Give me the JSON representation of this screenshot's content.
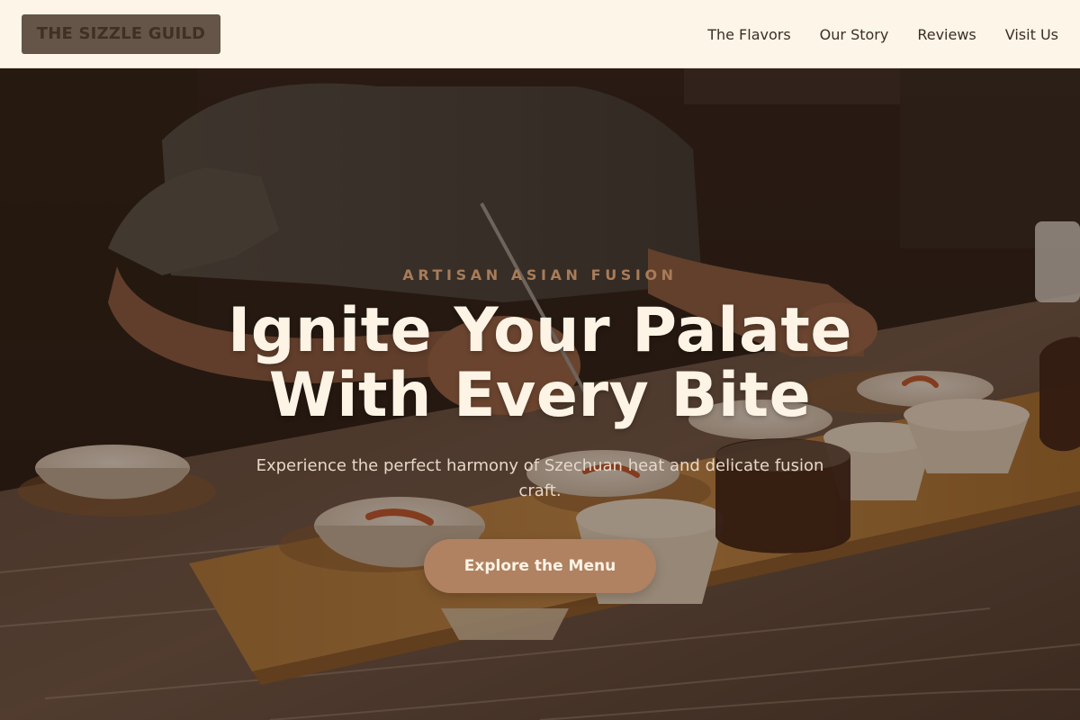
{
  "header": {
    "logo_text": "THE SIZZLE GUILD",
    "nav": [
      {
        "label": "The Flavors"
      },
      {
        "label": "Our Story"
      },
      {
        "label": "Reviews"
      },
      {
        "label": "Visit Us"
      }
    ]
  },
  "hero": {
    "eyebrow": "ARTISAN ASIAN FUSION",
    "title_line1": "Ignite Your Palate",
    "title_line2": "With Every Bite",
    "subtitle": "Experience the perfect harmony of Szechuan heat and delicate fusion craft.",
    "cta_label": "Explore the Menu"
  },
  "colors": {
    "header_bg": "#fdf5e8",
    "logo_bg": "#645548",
    "accent": "#b08262",
    "eyebrow": "#a97c58",
    "hero_text": "#fdf4e6"
  }
}
